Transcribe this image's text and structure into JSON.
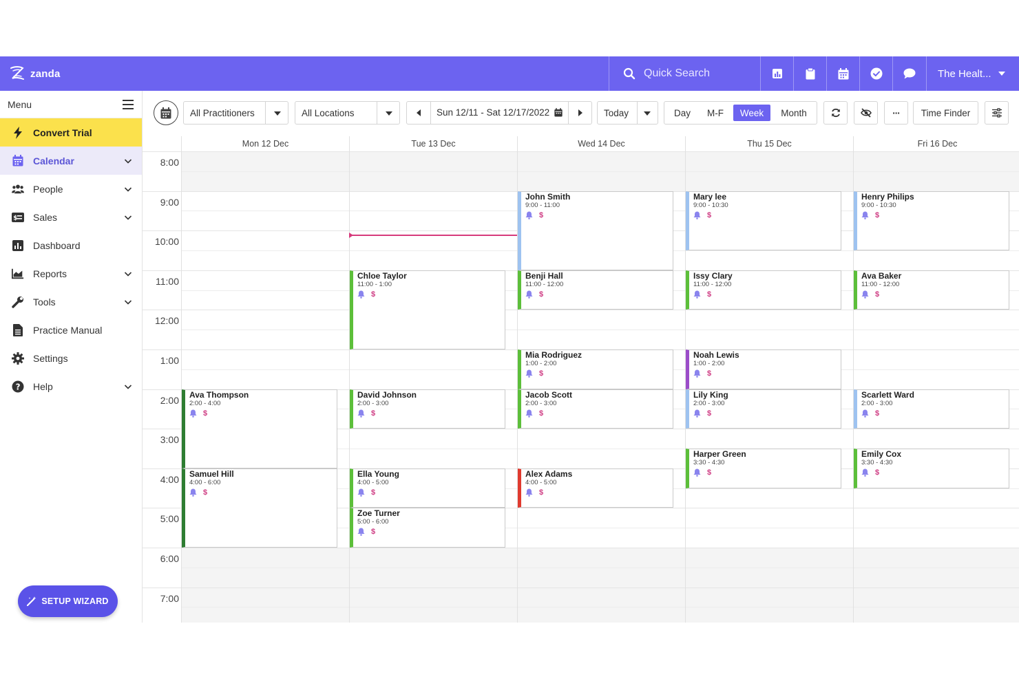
{
  "app": {
    "logo_text": "zanda"
  },
  "topbar": {
    "search_placeholder": "Quick Search",
    "icons": [
      "reports-icon",
      "clipboard-icon",
      "calendar-icon",
      "check-circle-icon",
      "chat-icon"
    ],
    "account_label": "The Healt..."
  },
  "sidebar": {
    "menu_label": "Menu",
    "items": [
      {
        "label": "Convert Trial",
        "icon": "lightning-icon",
        "expandable": false
      },
      {
        "label": "Calendar",
        "icon": "calendar-icon",
        "expandable": true
      },
      {
        "label": "People",
        "icon": "people-icon",
        "expandable": true
      },
      {
        "label": "Sales",
        "icon": "sales-icon",
        "expandable": true
      },
      {
        "label": "Dashboard",
        "icon": "dashboard-icon",
        "expandable": false
      },
      {
        "label": "Reports",
        "icon": "reports-icon",
        "expandable": true
      },
      {
        "label": "Tools",
        "icon": "wrench-icon",
        "expandable": true
      },
      {
        "label": "Practice Manual",
        "icon": "document-icon",
        "expandable": false
      },
      {
        "label": "Settings",
        "icon": "gear-icon",
        "expandable": false
      },
      {
        "label": "Help",
        "icon": "help-icon",
        "expandable": true
      }
    ],
    "setup_wizard": "SETUP WIZARD"
  },
  "toolbar": {
    "practitioners": "All Practitioners",
    "locations": "All Locations",
    "date_range": "Sun 12/11 - Sat 12/17/2022",
    "today": "Today",
    "views": [
      "Day",
      "M-F",
      "Week",
      "Month"
    ],
    "active_view": "Week",
    "more": "···",
    "time_finder": "Time Finder"
  },
  "calendar": {
    "days": [
      "Mon 12 Dec",
      "Tue 13 Dec",
      "Wed 14 Dec",
      "Thu 15 Dec",
      "Fri 16 Dec"
    ],
    "hours": [
      "8:00",
      "9:00",
      "10:00",
      "11:00",
      "12:00",
      "1:00",
      "2:00",
      "3:00",
      "4:00",
      "5:00",
      "6:00",
      "7:00"
    ],
    "current_time_day": 1,
    "current_time_hour": 10.1,
    "appointments": [
      {
        "name": "John Smith",
        "time": "9:00 - 11:00",
        "day": 2,
        "start": 9,
        "end": 11,
        "color": "#9ec3f0"
      },
      {
        "name": "Mary lee",
        "time": "9:00 - 10:30",
        "day": 3,
        "start": 9,
        "end": 10.5,
        "color": "#9ec3f0"
      },
      {
        "name": "Henry Philips",
        "time": "9:00 - 10:30",
        "day": 4,
        "start": 9,
        "end": 10.5,
        "color": "#9ec3f0"
      },
      {
        "name": "Chloe Taylor",
        "time": "11:00 - 1:00",
        "day": 1,
        "start": 11,
        "end": 13,
        "color": "#5cbf3a"
      },
      {
        "name": "Benji Hall",
        "time": "11:00 - 12:00",
        "day": 2,
        "start": 11,
        "end": 12,
        "color": "#5cbf3a"
      },
      {
        "name": "Issy Clary",
        "time": "11:00 - 12:00",
        "day": 3,
        "start": 11,
        "end": 12,
        "color": "#5cbf3a"
      },
      {
        "name": "Ava Baker",
        "time": "11:00 - 12:00",
        "day": 4,
        "start": 11,
        "end": 12,
        "color": "#5cbf3a"
      },
      {
        "name": "Mia Rodriguez",
        "time": "1:00 - 2:00",
        "day": 2,
        "start": 13,
        "end": 14,
        "color": "#5cbf3a"
      },
      {
        "name": "Noah Lewis",
        "time": "1:00 - 2:00",
        "day": 3,
        "start": 13,
        "end": 14,
        "color": "#9b4dc9"
      },
      {
        "name": "Ava Thompson",
        "time": "2:00 - 4:00",
        "day": 0,
        "start": 14,
        "end": 16,
        "color": "#2e7d32"
      },
      {
        "name": "David Johnson",
        "time": "2:00 - 3:00",
        "day": 1,
        "start": 14,
        "end": 15,
        "color": "#5cbf3a"
      },
      {
        "name": "Jacob Scott",
        "time": "2:00 - 3:00",
        "day": 2,
        "start": 14,
        "end": 15,
        "color": "#5cbf3a"
      },
      {
        "name": "Lily King",
        "time": "2:00 - 3:00",
        "day": 3,
        "start": 14,
        "end": 15,
        "color": "#9ec3f0"
      },
      {
        "name": "Scarlett Ward",
        "time": "2:00 - 3:00",
        "day": 4,
        "start": 14,
        "end": 15,
        "color": "#9ec3f0"
      },
      {
        "name": "Harper Green",
        "time": "3:30 - 4:30",
        "day": 3,
        "start": 15.5,
        "end": 16.5,
        "color": "#5cbf3a"
      },
      {
        "name": "Emily Cox",
        "time": "3:30 - 4:30",
        "day": 4,
        "start": 15.5,
        "end": 16.5,
        "color": "#5cbf3a"
      },
      {
        "name": "Samuel Hill",
        "time": "4:00 - 6:00",
        "day": 0,
        "start": 16,
        "end": 18,
        "color": "#2e7d32"
      },
      {
        "name": "Ella Young",
        "time": "4:00 - 5:00",
        "day": 1,
        "start": 16,
        "end": 17,
        "color": "#5cbf3a"
      },
      {
        "name": "Alex Adams",
        "time": "4:00 - 5:00",
        "day": 2,
        "start": 16,
        "end": 17,
        "color": "#e03a2f"
      },
      {
        "name": "Zoe Turner",
        "time": "5:00 - 6:00",
        "day": 1,
        "start": 17,
        "end": 18,
        "color": "#5cbf3a"
      }
    ],
    "dollar_symbol": "$"
  }
}
